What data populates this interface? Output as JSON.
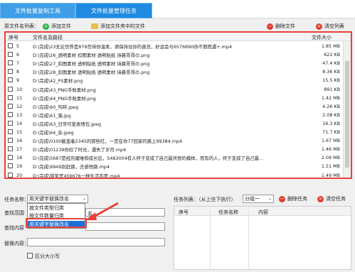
{
  "tabs": [
    "文件批量复制工具",
    "文件批量管理任务"
  ],
  "toolbar": {
    "list_label": "原文件名列表：",
    "add_file": "添加文件",
    "add_folder": "添加文件夹中的文件",
    "delete_file": "删除文件",
    "clear_list": "清空列表"
  },
  "file_table": {
    "headers": {
      "no": "序号",
      "path": "文件名及路径",
      "size": "文件大小"
    },
    "rows": [
      {
        "no": "5",
        "path": "D:\\完成\\23无论世界是879否待你温柔，请保持住你的善良，好运会与6576890你不期而遇+.mp4",
        "size": "1.85 MB"
      },
      {
        "no": "6",
        "path": "D:\\完成\\26_透明素材 扣图素材 透明贴纸 诗晨哥哥の.png",
        "size": "622 KB"
      },
      {
        "no": "7",
        "path": "D:\\完成\\27_扣图素材 透明贴纸 透明素材 诗晨哥哥の.png",
        "size": "47.4 KB"
      },
      {
        "no": "8",
        "path": "D:\\完成\\28_扣图素材 透明贴纸 透明素材 诗晨哥哥の.png",
        "size": "8.36 KB"
      },
      {
        "no": "9",
        "path": "D:\\完成\\42_PS素材.png",
        "size": "15.5 KB"
      },
      {
        "no": "10",
        "path": "D:\\完成\\43_PNG手账素材.png",
        "size": "891 KB"
      },
      {
        "no": "11",
        "path": "D:\\完成\\44_PNG手账素材.png",
        "size": "1.42 MB"
      },
      {
        "no": "12",
        "path": "D:\\完成\\60_呜呼.jpeg",
        "size": "4.26 KB"
      },
      {
        "no": "13",
        "path": "D:\\完成\\61_猫.jpg",
        "size": "2.08 KB"
      },
      {
        "no": "14",
        "path": "D:\\完成\\63_日常可爱表情包.jpeg",
        "size": "16.3 KB"
      },
      {
        "no": "15",
        "path": "D:\\完成\\64_杂.jpeg",
        "size": "71.7 KB"
      },
      {
        "no": "16",
        "path": "D:\\完成\\0100截盖着2345的那些红，一定在你77回家的路上99384.mp4",
        "size": "1.67 MB"
      },
      {
        "no": "17",
        "path": "D:\\完成\\01239你捡了时光，遇失了岁月.mp4",
        "size": "1.46 MB"
      },
      {
        "no": "18",
        "path": "D:\\完成\\5687是经历磨难和成长后，5483004有人终于变成了自己最厌恨的模样，而有的人，终于变成了自己最...",
        "size": "2.09 MB"
      },
      {
        "no": "19",
        "path": "D:\\完成\\9949别赶路，去感悟路.mp4",
        "size": "1.51 MB"
      },
      {
        "no": "20",
        "path": "D:\\完成\\简笑是456676一种生活态度.mp4",
        "size": "1.49 MB"
      }
    ]
  },
  "bottom_left": {
    "task_name_label": "任务名称：",
    "task_name_value": "用关键字替换改名",
    "dropdown_options": [
      "按文件类型归类",
      "按文件数量归类",
      "用关键字替换改名"
    ],
    "find_range_label": "查找范围",
    "find_content_label": "查找内容",
    "find_content_partial": "名",
    "replace_label": "替换内容：",
    "case_label": "区分大小写"
  },
  "bottom_right": {
    "task_list_label": "任务列表：（从上往下执行）",
    "group_value": "分组一",
    "delete_task": "删除任务",
    "clear_task": "清空任务",
    "headers": {
      "no": "序号",
      "name": "任务名称",
      "content": "内容"
    }
  },
  "colors": {
    "highlight": "#e8413a",
    "tab_active": "#1f8ae0",
    "selection": "#1f6fd8"
  }
}
